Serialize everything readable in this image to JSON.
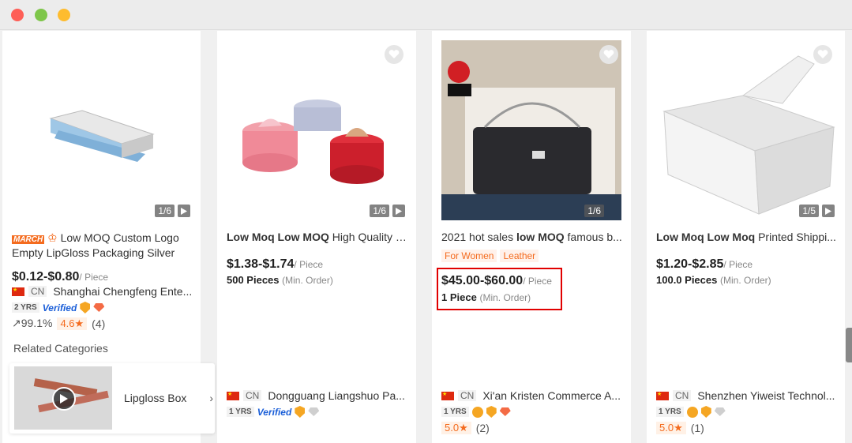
{
  "window": {
    "controls": [
      "close",
      "minimize",
      "zoom"
    ]
  },
  "products": [
    {
      "image_counter": "1/6",
      "badge": "MARCH",
      "title_plain": "Low MOQ Custom Logo",
      "title_line2": "Empty LipGloss Packaging Silver",
      "price": "$0.12-$0.80",
      "price_unit": "/ Piece",
      "country": "CN",
      "supplier": "Shanghai Chengfeng Ente...",
      "years": "2 YRS",
      "verified": "Verified",
      "response_rate": "99.1%",
      "score": "4.6",
      "reviews": "(4)"
    },
    {
      "image_counter": "1/6",
      "title_bold": "Low Moq Low MOQ",
      "title_rest": " High Quality C...",
      "price": "$1.38-$1.74",
      "price_unit": "/ Piece",
      "moq": "500 Pieces",
      "moq_unit": "(Min. Order)",
      "country": "CN",
      "supplier": "Dongguang Liangshuo Pa...",
      "years": "1 YRS",
      "verified": "Verified"
    },
    {
      "image_counter": "1/6",
      "title_pre": "2021 hot sales ",
      "title_bold": "low MOQ",
      "title_rest": " famous b...",
      "tags": [
        "For Women",
        "Leather"
      ],
      "price": "$45.00-$60.00",
      "price_unit": "/ Piece",
      "moq": "1 Piece",
      "moq_unit": "(Min. Order)",
      "country": "CN",
      "supplier": "Xi'an Kristen Commerce A...",
      "years": "1 YRS",
      "score": "5.0",
      "reviews": "(2)"
    },
    {
      "image_counter": "1/5",
      "title_bold": "Low Moq Low Moq",
      "title_rest": " Printed Shippi...",
      "price": "$1.20-$2.85",
      "price_unit": "/ Piece",
      "moq": "100.0 Pieces",
      "moq_unit": "(Min. Order)",
      "country": "CN",
      "supplier": "Shenzhen Yiweist Technol...",
      "years": "1 YRS",
      "score": "5.0",
      "reviews": "(1)"
    }
  ],
  "related": {
    "heading": "Related Categories",
    "item_label": "Lipgloss Box"
  },
  "colors": {
    "accent": "#f46b1e",
    "highlight": "#e10000",
    "verified": "#1a5ed8"
  }
}
